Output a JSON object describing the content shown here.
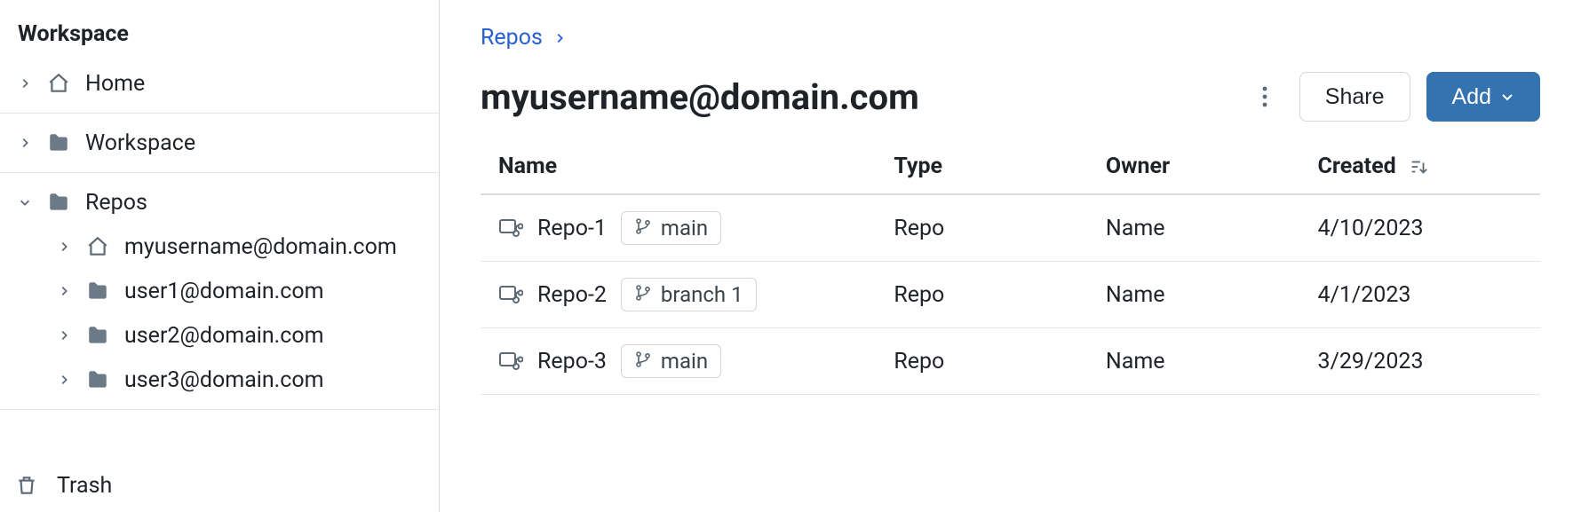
{
  "sidebar": {
    "heading": "Workspace",
    "home_label": "Home",
    "workspace_label": "Workspace",
    "repos_label": "Repos",
    "repo_users": [
      {
        "label": "myusername@domain.com",
        "icon": "home"
      },
      {
        "label": "user1@domain.com",
        "icon": "folder"
      },
      {
        "label": "user2@domain.com",
        "icon": "folder"
      },
      {
        "label": "user3@domain.com",
        "icon": "folder"
      }
    ],
    "trash_label": "Trash"
  },
  "breadcrumb": {
    "items": [
      "Repos"
    ]
  },
  "header": {
    "title": "myusername@domain.com",
    "share_label": "Share",
    "add_label": "Add"
  },
  "table": {
    "columns": {
      "name": "Name",
      "type": "Type",
      "owner": "Owner",
      "created": "Created"
    },
    "rows": [
      {
        "name": "Repo-1",
        "branch": "main",
        "type": "Repo",
        "owner": "Name",
        "created": "4/10/2023"
      },
      {
        "name": "Repo-2",
        "branch": "branch 1",
        "type": "Repo",
        "owner": "Name",
        "created": "4/1/2023"
      },
      {
        "name": "Repo-3",
        "branch": "main",
        "type": "Repo",
        "owner": "Name",
        "created": "3/29/2023"
      }
    ]
  }
}
